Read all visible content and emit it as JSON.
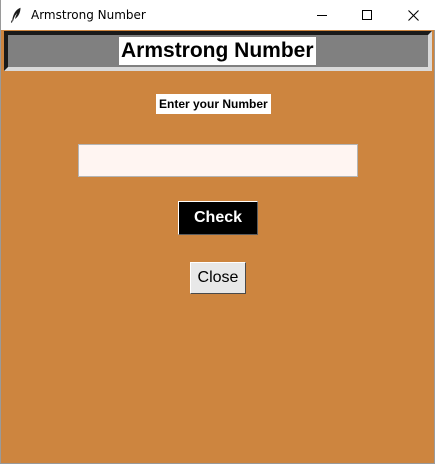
{
  "window": {
    "title": "Armstrong Number",
    "icon": "feather-icon",
    "controls": {
      "minimize_icon": "minimize-icon",
      "maximize_icon": "maximize-icon",
      "close_icon": "close-icon"
    }
  },
  "app": {
    "heading": "Armstrong Number",
    "prompt_label": "Enter your Number",
    "number_input": {
      "value": "",
      "placeholder": ""
    },
    "check_label": "Check",
    "close_label": "Close"
  },
  "colors": {
    "background": "#cd853f",
    "banner": "#808080",
    "input_background": "#fff5f2",
    "check_button": "#000000",
    "close_button": "#e8e8e8"
  }
}
